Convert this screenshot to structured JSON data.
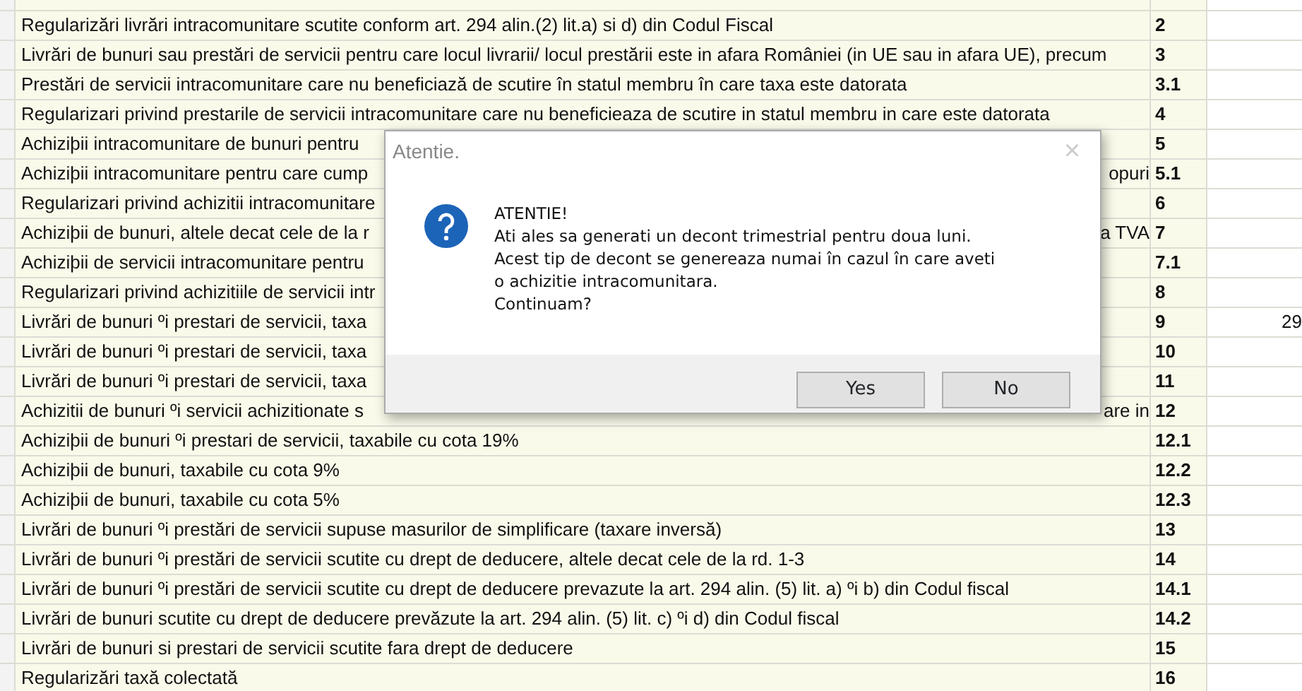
{
  "table": {
    "rows": [
      {
        "description": "Regularizări livrări intracomunitare scutite conform art. 294 alin.(2)  lit.a) si d) din Codul Fiscal",
        "number": "2"
      },
      {
        "description": "Livrări de bunuri sau prestări de servicii pentru care locul livrarii/ locul prestării este in afara României (in UE sau in afara UE), precum",
        "number": "3"
      },
      {
        "description": "Prestări de servicii intracomunitare care nu beneficiază de scutire în statul membru în care taxa este datorata",
        "number": "3.1"
      },
      {
        "description": "Regularizari privind prestarile de servicii intracomunitare care nu beneficieaza de scutire in statul membru in care este datorata",
        "number": "4"
      },
      {
        "description": "Achiziþii intracomunitare de bunuri pentru",
        "number": "5"
      },
      {
        "description": "Achiziþii intracomunitare pentru care cump",
        "description_end": "opuri",
        "number": "5.1"
      },
      {
        "description": "Regularizari privind achizitii intracomunitare",
        "number": "6"
      },
      {
        "description": "Achiziþii de bunuri, altele decat cele de la r",
        "description_end": "a TVA",
        "number": "7"
      },
      {
        "description": "Achiziþii de servicii intracomunitare pentru",
        "number": "7.1"
      },
      {
        "description": "Regularizari privind achizitiile de servicii intr",
        "number": "8"
      },
      {
        "description": "Livrări de bunuri ºi prestari de servicii, taxa",
        "number": "9",
        "value": "29"
      },
      {
        "description": "Livrări de bunuri ºi prestari de servicii, taxa",
        "number": "10"
      },
      {
        "description": "Livrări de bunuri ºi prestari de servicii, taxa",
        "number": "11"
      },
      {
        "description": "Achizitii de bunuri ºi servicii achizitionate s",
        "description_end": "are in",
        "number": "12"
      },
      {
        "description": "Achiziþii de bunuri ºi prestari de servicii, taxabile cu cota 19%",
        "number": "12.1"
      },
      {
        "description": "Achiziþii de bunuri, taxabile cu cota 9%",
        "number": "12.2"
      },
      {
        "description": "Achiziþii de bunuri, taxabile cu cota 5%",
        "number": "12.3"
      },
      {
        "description": "Livrări de bunuri ºi prestări de servicii supuse masurilor de simplificare (taxare inversă)",
        "number": "13"
      },
      {
        "description": "Livrări de bunuri ºi prestări de servicii scutite cu drept de deducere, altele decat cele de la rd. 1-3",
        "number": "14"
      },
      {
        "description": "Livrări de bunuri ºi prestări de servicii scutite cu drept de deducere prevazute la  art. 294 alin. (5) lit. a) ºi b) din Codul fiscal",
        "number": "14.1"
      },
      {
        "description": "Livrări de bunuri scutite cu drept de deducere prevăzute la  art. 294 alin. (5) lit. c) ºi d) din Codul fiscal",
        "number": "14.2"
      },
      {
        "description": "Livrări de bunuri si prestari de servicii scutite fara drept de deducere",
        "number": "15"
      },
      {
        "description": "Regularizări taxă colectată",
        "number": "16"
      }
    ]
  },
  "dialog": {
    "title": "Atentie.",
    "close": "×",
    "message": [
      "ATENTIE!",
      "Ati ales sa generati un decont trimestrial pentru doua luni.",
      "Acest tip de decont se genereaza numai în cazul în care aveti",
      "o achizitie intracomunitara.",
      "Continuam?"
    ],
    "buttons": [
      "Yes",
      "No"
    ]
  }
}
